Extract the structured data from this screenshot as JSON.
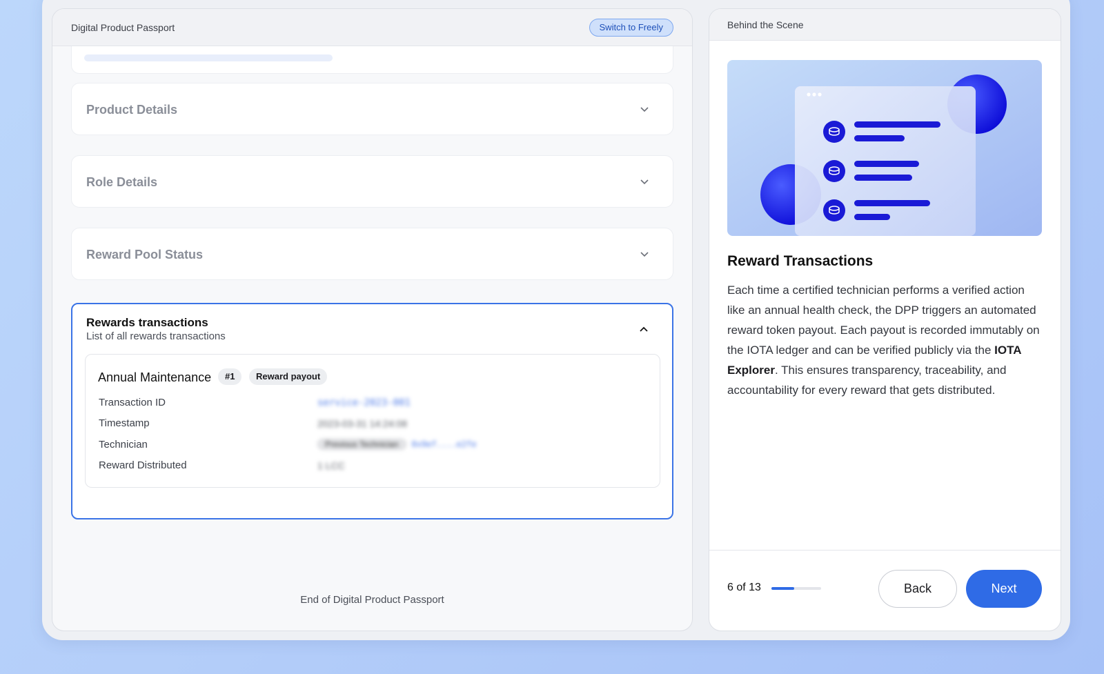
{
  "left_panel": {
    "title": "Digital Product Passport",
    "switch_label": "Switch to Freely",
    "sections": [
      {
        "label": "Product Details"
      },
      {
        "label": "Role Details"
      },
      {
        "label": "Reward Pool Status"
      }
    ],
    "rewards": {
      "title": "Rewards transactions",
      "subtitle": "List of all rewards transactions",
      "transaction": {
        "name": "Annual Maintenance",
        "index_badge": "#1",
        "type_badge": "Reward payout",
        "rows": [
          {
            "label": "Transaction ID",
            "value": "service-2023-001"
          },
          {
            "label": "Timestamp",
            "value": "2023-03-31 14:24:08"
          },
          {
            "label": "Technician",
            "role": "Previous Technician",
            "value": "0x9ef....e2fe"
          },
          {
            "label": "Reward Distributed",
            "value": "1 LCC"
          }
        ]
      }
    },
    "end_text": "End of Digital Product Passport"
  },
  "right_panel": {
    "title": "Behind the Scene",
    "heading": "Reward Transactions",
    "body_before": "Each time a certified technician performs a verified action like an annual health check, the DPP triggers an automated reward token payout. Each payout is recorded immutably on the IOTA ledger and can be verified publicly via the ",
    "body_bold": "IOTA Explorer",
    "body_after": ". This ensures transparency, traceability, and accountability for every reward that gets distributed.",
    "step_label": "6 of 13",
    "progress": 0.46,
    "back_label": "Back",
    "next_label": "Next"
  },
  "colors": {
    "accent": "#2f6be6",
    "illustration_blue": "#1f1fe0"
  },
  "icons": [
    "chevron-down-icon",
    "chevron-up-icon",
    "coin-icon"
  ]
}
